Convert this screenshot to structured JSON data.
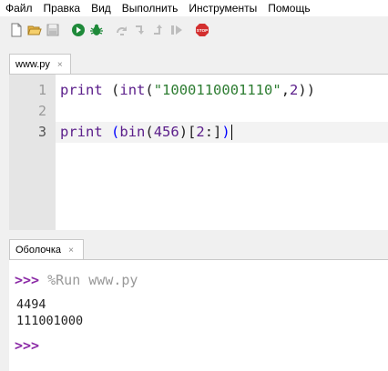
{
  "menubar": {
    "items": [
      "Файл",
      "Правка",
      "Вид",
      "Выполнить",
      "Инструменты",
      "Помощь"
    ]
  },
  "toolbar": {
    "buttons": [
      "new-file-icon",
      "open-folder-icon",
      "save-icon",
      "run-icon",
      "debug-icon",
      "step-over-icon",
      "step-into-icon",
      "step-out-icon",
      "resume-icon",
      "stop-icon"
    ],
    "stop_label": "STOP",
    "colors": {
      "run": "#1f8a3a",
      "debug": "#1f8a3a",
      "stop": "#d32f2f",
      "disabled": "#bdbdbd"
    }
  },
  "editor": {
    "tab": {
      "label": "www.py",
      "close": "×"
    },
    "line_numbers": [
      "1",
      "2",
      "3"
    ],
    "lines": [
      {
        "kw": "print",
        "sp": " ",
        "p1": "(",
        "fn": "int",
        "p2": "(",
        "str": "\"1000110001110\"",
        "comma": ",",
        "num": "2",
        "p3": "))"
      },
      {},
      {
        "kw": "print",
        "sp": " ",
        "p1": "(",
        "fn": "bin",
        "p2": "(",
        "num": "456",
        "p3": ")[",
        "num2": "2",
        "colon": ":]",
        "p4": ")"
      }
    ]
  },
  "shell": {
    "tab": {
      "label": "Оболочка",
      "close": "×"
    },
    "prompt": ">>>",
    "command": " %Run www.py",
    "output": [
      "4494",
      "111001000"
    ]
  }
}
